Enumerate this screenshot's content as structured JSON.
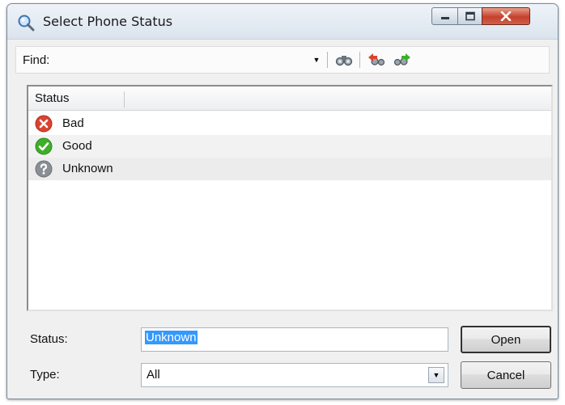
{
  "window": {
    "title": "Select Phone Status",
    "title_icon": "magnifier-icon"
  },
  "find_bar": {
    "label": "Find:",
    "value": "",
    "icons": [
      "binoculars-icon",
      "find-previous-icon",
      "find-next-icon"
    ]
  },
  "list": {
    "column_header": "Status",
    "rows": [
      {
        "label": "Bad",
        "icon": "error-red-x-icon",
        "color": "#d9442f"
      },
      {
        "label": "Good",
        "icon": "check-green-icon",
        "color": "#3fae2a"
      },
      {
        "label": "Unknown",
        "icon": "question-gray-icon",
        "color": "#8a8f95"
      }
    ],
    "selected_row": "Unknown"
  },
  "form": {
    "status_label": "Status:",
    "status_value": "Unknown",
    "type_label": "Type:",
    "type_value": "All"
  },
  "buttons": {
    "open": "Open",
    "cancel": "Cancel"
  },
  "colors": {
    "selection": "#3399ff",
    "close_button": "#c4412c"
  }
}
